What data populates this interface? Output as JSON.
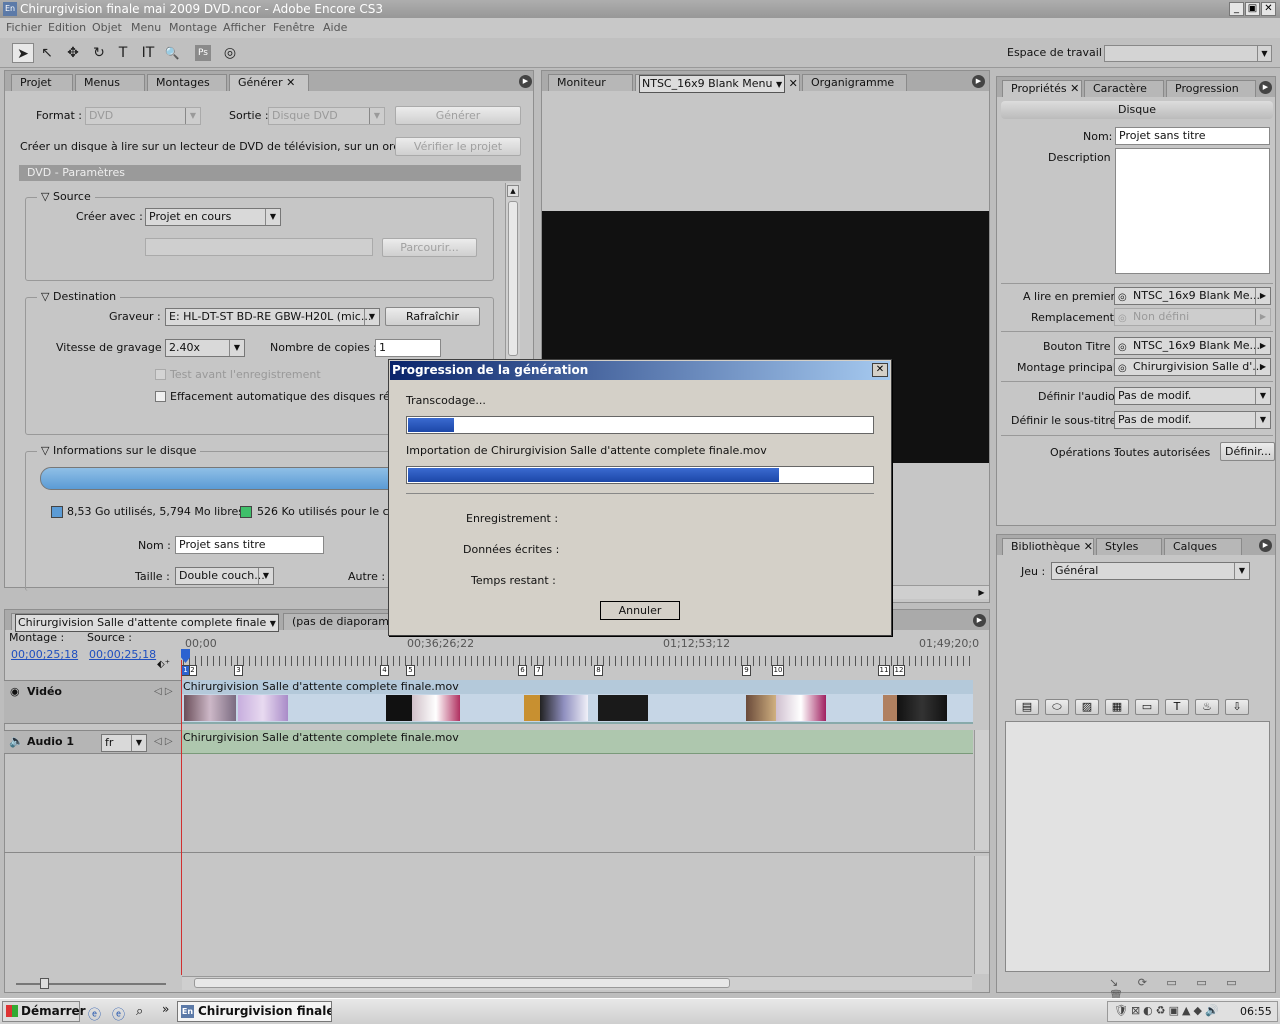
{
  "window": {
    "title": "Chirurgivision finale mai 2009 DVD.ncor - Adobe Encore CS3",
    "app_icon": "En",
    "buttons": [
      "_",
      "▣",
      "✕"
    ]
  },
  "menu": [
    "Fichier",
    "Edition",
    "Objet",
    "Menu",
    "Montage",
    "Afficher",
    "Fenêtre",
    "Aide"
  ],
  "toolbar": {
    "tools": [
      "selection-tool",
      "direct-select-tool",
      "move-tool",
      "rotate-tool",
      "text-tool",
      "vertical-text-tool",
      "zoom-tool",
      "photoshop-tool",
      "preview-tool"
    ],
    "tool_glyphs": [
      "➤",
      "↖",
      "✥",
      "↻",
      "T",
      "IT",
      "🔍",
      "Ps",
      "◎"
    ],
    "workspace_label": "Espace de travail :"
  },
  "left_panel": {
    "tabs": [
      "Projet",
      "Menus",
      "Montages",
      "Générer"
    ],
    "format_label": "Format :",
    "format_value": "DVD",
    "sortie_label": "Sortie :",
    "sortie_value": "Disque DVD",
    "generate_btn": "Générer",
    "description": "Créer un disque à lire sur un lecteur de DVD de télévision, sur un ordinate...",
    "verify_btn": "Vérifier le projet",
    "params_header": "DVD - Paramètres",
    "source": {
      "title": "Source",
      "create_label": "Créer avec :",
      "create_value": "Projet en cours",
      "browse_btn": "Parcourir..."
    },
    "destination": {
      "title": "Destination",
      "burner_label": "Graveur :",
      "burner_value": "E: HL-DT-ST BD-RE  GBW-H20L (mic...",
      "refresh_btn": "Rafraîchir",
      "speed_label": "Vitesse de gravage :",
      "speed_value": "2.40x",
      "copies_label": "Nombre de copies :",
      "copies_value": "1",
      "test_label": "Test avant l'enregistrement",
      "erase_label": "Effacement automatique des disques réenreg"
    },
    "disc_info": {
      "title": "Informations sur le disque",
      "used": "8,53 Go utilisés,  5,794 Mo libres.",
      "content": "526 Ko utilisés pour le conte",
      "name_label": "Nom :",
      "name_value": "Projet sans titre",
      "size_label": "Taille :",
      "size_value": "Double couch...",
      "other_label": "Autre :"
    }
  },
  "monitor": {
    "tabs": [
      "Moniteur",
      "NTSC_16x9 Blank Menu",
      "Organigramme"
    ]
  },
  "properties": {
    "tabs": [
      "Propriétés",
      "Caractère",
      "Progression"
    ],
    "header": "Disque",
    "name_label": "Nom:",
    "name_value": "Projet sans titre",
    "desc_label": "Description :",
    "rows": [
      {
        "label": "A lire en premier :",
        "value": "NTSC_16x9 Blank Me..."
      },
      {
        "label": "Remplacement :",
        "value": "Non défini"
      },
      {
        "label": "Bouton Titre :",
        "value": "NTSC_16x9 Blank Me..."
      },
      {
        "label": "Montage principal :",
        "value": "Chirurgivision Salle d'..."
      }
    ],
    "audio_label": "Définir l'audio :",
    "audio_value": "Pas de modif.",
    "subtitle_label": "Définir le sous-titre :",
    "subtitle_value": "Pas de modif.",
    "ops_label": "Opérations :",
    "ops_value": "Toutes autorisées",
    "define_btn": "Définir..."
  },
  "library": {
    "tabs": [
      "Bibliothèque",
      "Styles",
      "Calques"
    ],
    "set_label": "Jeu :",
    "set_value": "Général",
    "icons": [
      "list-view-icon",
      "shape-icon",
      "image-icon",
      "menu-icon",
      "folder-icon",
      "text-icon",
      "drop-icon",
      "import-icon"
    ],
    "icon_glyphs": [
      "▤",
      "⬭",
      "▨",
      "▦",
      "▭",
      "T",
      "♨",
      "⇩"
    ]
  },
  "timeline": {
    "tab1": "Chirurgivision Salle d'attente complete finale",
    "tab2": "(pas de diaporama)",
    "montage_label": "Montage :",
    "montage_tc": "00;00;25;18",
    "source_label": "Source :",
    "source_tc": "00;00;25;18",
    "ruler": [
      "00;00",
      "00;36;26;22",
      "01;12;53;12",
      "01;49;20;0"
    ],
    "markers": [
      "1",
      "2",
      "3",
      "4",
      "5",
      "6",
      "7",
      "8",
      "9",
      "10",
      "11",
      "12"
    ],
    "video_label": "Vidéo",
    "video_clip": "Chirurgivision Salle d'attente complete finale.mov",
    "audio_label": "Audio 1",
    "audio_lang": "fr",
    "audio_clip": "Chirurgivision Salle d'attente complete finale.mov"
  },
  "dialog": {
    "title": "Progression de la génération",
    "status1": "Transcodage...",
    "progress1": 0.1,
    "status2": "Importation de Chirurgivision Salle d'attente complete finale.mov",
    "progress2": 0.8,
    "recording_label": "Enregistrement :",
    "written_label": "Données écrites :",
    "remaining_label": "Temps restant :",
    "cancel_btn": "Annuler"
  },
  "taskbar": {
    "start": "Démarrer",
    "task": "Chirurgivision finale ...",
    "task_icon": "En",
    "clock": "06:55",
    "more": "»"
  },
  "colors": {
    "progress": "#1d47a8",
    "used_swatch": "#5b9bd5",
    "content_swatch": "#3fbf6a",
    "timeline_cursor": "#d03030"
  }
}
